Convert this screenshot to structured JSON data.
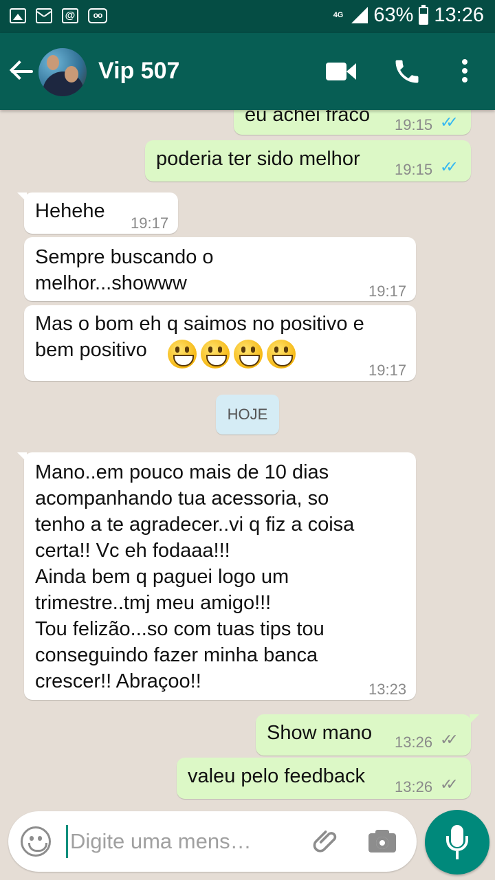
{
  "status_bar": {
    "network": "4G",
    "battery": "63%",
    "time": "13:26"
  },
  "header": {
    "contact_name": "Vip 507"
  },
  "messages": [
    {
      "direction": "out",
      "text": "eu achei fraco",
      "time": "19:15",
      "status": "read"
    },
    {
      "direction": "out",
      "text": "poderia ter sido melhor",
      "time": "19:15",
      "status": "read"
    },
    {
      "direction": "in",
      "text": "Hehehe",
      "time": "19:17"
    },
    {
      "direction": "in",
      "text": "Sempre buscando o\nmelhor...showww",
      "time": "19:17"
    },
    {
      "direction": "in",
      "text": "Mas o bom eh q saimos no positivo e\nbem positivo",
      "emoji_count": 4,
      "time": "19:17"
    },
    {
      "direction": "in",
      "text": "Mano..em pouco mais de 10 dias\nacompanhando tua acessoria, so\ntenho a te agradecer..vi q fiz a coisa\ncerta!! Vc eh fodaaa!!!\nAinda bem q paguei logo um\ntrimestre..tmj meu amigo!!!\nTou felizão...so com tuas tips tou\nconseguindo fazer minha banca\ncrescer!! Abraçoo!!",
      "time": "13:23"
    },
    {
      "direction": "out",
      "text": "Show mano",
      "time": "13:26",
      "status": "delivered"
    },
    {
      "direction": "out",
      "text": "valeu pelo feedback",
      "time": "13:26",
      "status": "delivered"
    }
  ],
  "date_separator": "HOJE",
  "composer": {
    "placeholder": "Digite uma mens…"
  },
  "icons": {
    "back": "arrow-left-icon",
    "video": "video-call-icon",
    "phone": "phone-icon",
    "menu": "more-vert-icon",
    "emoji": "emoji-icon",
    "attach": "paperclip-icon",
    "camera": "camera-icon",
    "mic": "mic-icon",
    "read_tick": "double-check-icon"
  },
  "colors": {
    "header": "#075e54",
    "status_bar": "#054d44",
    "outgoing_bubble": "#dcf8c6",
    "incoming_bubble": "#ffffff",
    "chat_background": "#e5ddd5",
    "read_ticks": "#34b7f1",
    "mic_button": "#00897b"
  }
}
